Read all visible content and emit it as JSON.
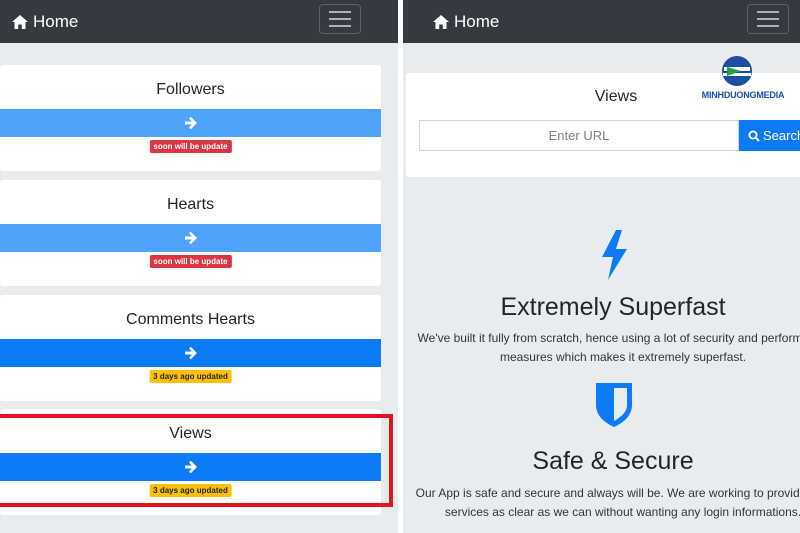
{
  "navbar": {
    "home_label": "Home"
  },
  "left": {
    "cards": [
      {
        "title": "Followers",
        "badge": "soon will be update",
        "badge_kind": "red",
        "button_color": "#4fa3fb"
      },
      {
        "title": "Hearts",
        "badge": "soon will be update",
        "badge_kind": "red",
        "button_color": "#4fa3fb"
      },
      {
        "title": "Comments Hearts",
        "badge": "3 days ago updated",
        "badge_kind": "yellow",
        "button_color": "#0d7bf7"
      },
      {
        "title": "Views",
        "badge": "3 days ago updated",
        "badge_kind": "yellow",
        "button_color": "#0d7bf7"
      }
    ]
  },
  "right": {
    "search": {
      "title": "Views",
      "placeholder": "Enter URL",
      "button_label": "Search"
    },
    "watermark": {
      "text": "MINHDUONGMEDIA"
    },
    "features": [
      {
        "title": "Extremely Superfast",
        "text": "We've built it fully from scratch, hence using a lot of security and performance measures which makes it extremely superfast.",
        "icon": "bolt-icon"
      },
      {
        "title": "Safe & Secure",
        "text": "Our App is safe and secure and always will be. We are working to provide free services as clear as we can without wanting any login informations.",
        "icon": "shield-icon"
      }
    ]
  },
  "colors": {
    "navbar": "#343a40",
    "accent": "#0d7bf7",
    "light_accent": "#4fa3fb",
    "badge_red": "#dc3545",
    "badge_yellow": "#ffc107",
    "highlight": "#e0161e"
  }
}
